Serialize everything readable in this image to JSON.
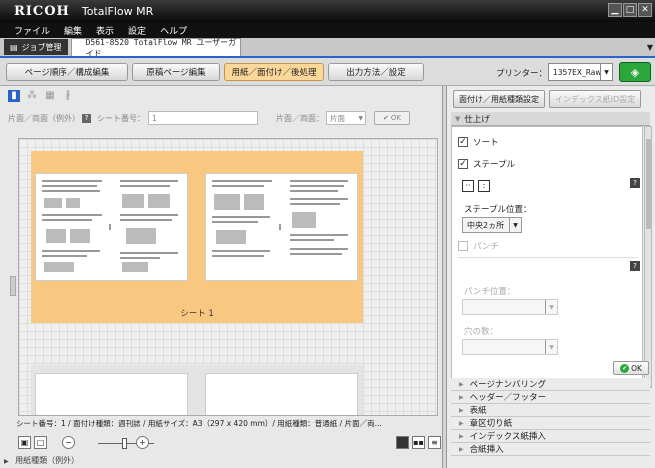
{
  "titlebar": {
    "logo": "RICOH",
    "app_name": "TotalFlow MR"
  },
  "menu": {
    "items": [
      "ファイル",
      "編集",
      "表示",
      "設定",
      "ヘルプ"
    ]
  },
  "tabs": {
    "job_manage": "ジョブ管理",
    "doc_tab": "D561-8520 TotalFlow MR ユーザーガイド"
  },
  "toolbar": {
    "buttons": [
      "ページ順序／構成編集",
      "原稿ページ編集",
      "用紙／面付け／後処理",
      "出力方法／設定"
    ],
    "printer_label": "プリンター：",
    "printer_value": "1357EX_Raw",
    "colors": {
      "active": "#fbd79a",
      "go": "#2aa83c",
      "accent": "#2a64c8"
    }
  },
  "left": {
    "sides_label": "片面／両面（例外）",
    "sheet_no_label": "シート番号：",
    "sheet_no_value": "1",
    "sides_label2": "片面／両面：",
    "sides_value": "片面",
    "ok_label": "OK",
    "sheet_label": "シート 1",
    "status": "シート番号：1 / 面付け種類：週刊誌 / 用紙サイズ：A3（297 x 420 mm）/ 用紙種類：普通紙 / 片面／両...",
    "paper_type_row": "用紙種類（例外）"
  },
  "right": {
    "tab1": "面付け／用紙種類設定",
    "tab2": "インデックス紙ID設定",
    "section_title": "仕上げ",
    "sort_label": "ソート",
    "staple_label": "ステープル",
    "staple_pos_label": "ステープル位置：",
    "staple_pos_value": "中央2ヵ所",
    "punch_label": "パンチ",
    "punch_pos_label": "パンチ位置：",
    "hole_count_label": "穴の数：",
    "ok_label": "OK",
    "collapsed": [
      "ページナンバリング",
      "ヘッダー／フッター",
      "表紙",
      "章区切り紙",
      "インデックス紙挿入",
      "合紙挿入"
    ]
  }
}
